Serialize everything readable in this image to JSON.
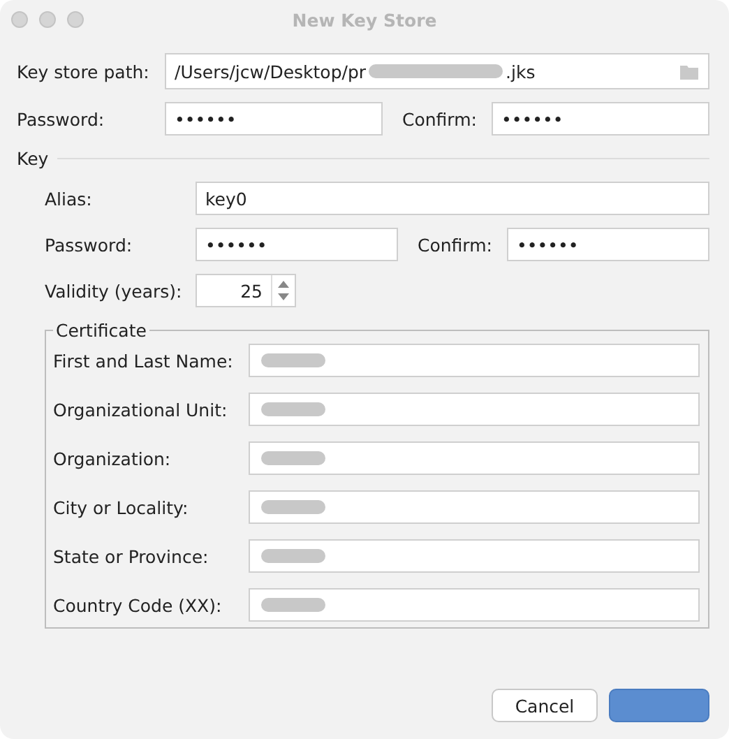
{
  "window": {
    "title": "New Key Store"
  },
  "key_store": {
    "path_label": "Key store path:",
    "path_start": "/Users/jcw/Desktop/pr",
    "path_redacted": true,
    "path_end": ".jks",
    "password_label": "Password:",
    "password": "••••••",
    "confirm_label": "Confirm:",
    "confirm": "••••••"
  },
  "key": {
    "title": "Key",
    "alias_label": "Alias:",
    "alias": "key0",
    "password_label": "Password:",
    "password": "••••••",
    "confirm_label": "Confirm:",
    "confirm": "••••••",
    "validity_label": "Validity (years):",
    "validity": "25"
  },
  "certificate": {
    "title": "Certificate",
    "fields": [
      {
        "label": "First and Last Name:",
        "redacted": true
      },
      {
        "label": "Organizational Unit:",
        "redacted": true
      },
      {
        "label": "Organization:",
        "redacted": true
      },
      {
        "label": "City or Locality:",
        "redacted": true
      },
      {
        "label": "State or Province:",
        "redacted": true
      },
      {
        "label": "Country Code (XX):",
        "redacted": true
      }
    ]
  },
  "buttons": [
    {
      "label": "Cancel",
      "kind": "secondary"
    },
    {
      "kind": "primary"
    }
  ]
}
